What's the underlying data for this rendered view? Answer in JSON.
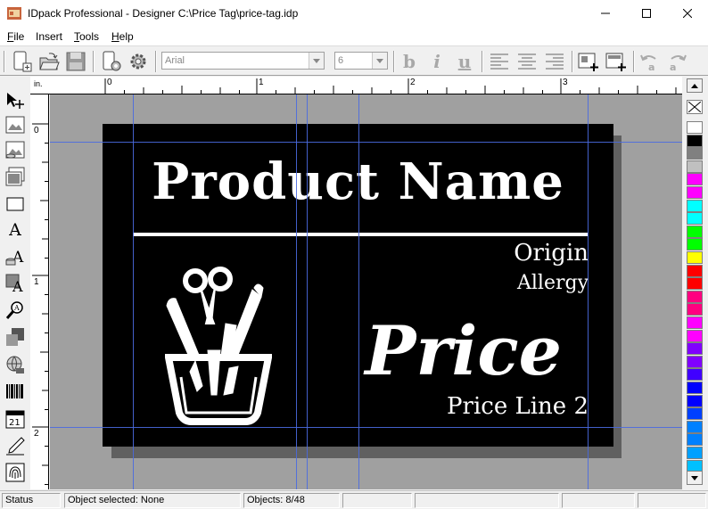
{
  "window": {
    "title": "IDpack Professional - Designer C:\\Price Tag\\price-tag.idp",
    "minimize_label": "—",
    "maximize_label": "☐",
    "close_label": "✕"
  },
  "menu": {
    "items": [
      {
        "label": "File",
        "underline": "F",
        "rest": "ile"
      },
      {
        "label": "Insert"
      },
      {
        "label": "Tools",
        "underline": "T",
        "rest": "ools"
      },
      {
        "label": "Help",
        "underline": "H",
        "rest": "elp"
      }
    ]
  },
  "toolbar": {
    "font_name": "Arial",
    "font_size": "6",
    "bold_label": "b",
    "italic_label": "i",
    "underline_label": "u"
  },
  "rulers": {
    "units": "in.",
    "h_labels": [
      "0",
      "1",
      "2",
      "3"
    ],
    "v_labels": [
      "0",
      "1",
      "2"
    ]
  },
  "label_design": {
    "product_name": "Product Name",
    "origin": "Origin",
    "allergy": "Allergy",
    "price": "Price",
    "price_line2": "Price Line 2",
    "background_color": "#000000",
    "text_color": "#ffffff"
  },
  "palette": {
    "colors": [
      "#ffffff",
      "#000000",
      "#808080",
      "#c0c0c0",
      "#ff00ff",
      "#ff00ff",
      "#00ffff",
      "#00ffff",
      "#00ff00",
      "#00ff00",
      "#ffff00",
      "#ff0000",
      "#ff0000",
      "#ff0080",
      "#ff0080",
      "#ff00ff",
      "#ff00ff",
      "#8000ff",
      "#8000ff",
      "#4000ff",
      "#0000ff",
      "#0000ff",
      "#0040ff",
      "#0080ff",
      "#0080ff",
      "#00a0ff",
      "#00c0ff",
      "#00e0ff"
    ]
  },
  "status": {
    "status_label": "Status",
    "object_selected": "Object selected: None",
    "objects_count": "Objects: 8/48"
  },
  "colors": {
    "guide": "#4a6ae0",
    "canvas_bg": "#a0a0a0"
  }
}
